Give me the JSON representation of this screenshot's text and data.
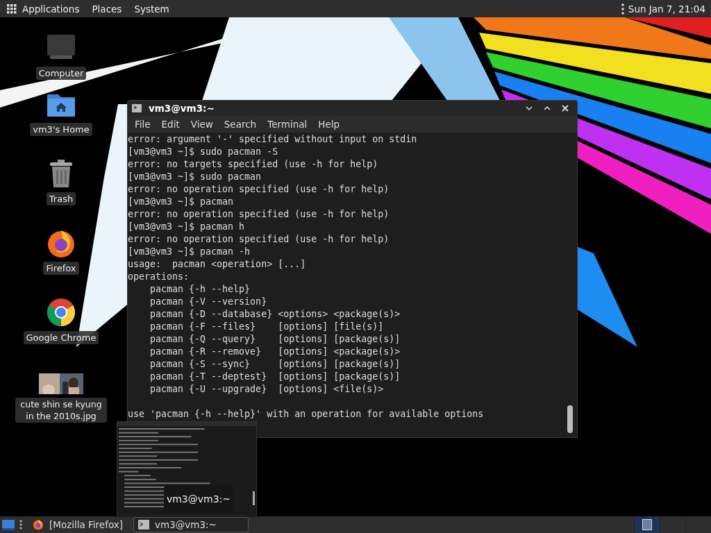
{
  "top_panel": {
    "menus": [
      "Applications",
      "Places",
      "System"
    ],
    "clock": "Sun Jan 7, 21:04"
  },
  "desktop_icons": [
    {
      "kind": "computer",
      "label": "Computer"
    },
    {
      "kind": "home",
      "label": "vm3's Home"
    },
    {
      "kind": "trash",
      "label": "Trash"
    },
    {
      "kind": "firefox",
      "label": "Firefox"
    },
    {
      "kind": "chrome",
      "label": "Google Chrome"
    },
    {
      "label": "cute shin se kyung in the 2010s.jpg"
    }
  ],
  "terminal": {
    "title": "vm3@vm3:~",
    "menu": [
      "File",
      "Edit",
      "View",
      "Search",
      "Terminal",
      "Help"
    ],
    "lines": [
      {
        "kind": "text",
        "text": "error: argument '-' specified without input on stdin"
      },
      {
        "kind": "text",
        "text": "[vm3@vm3 ~]$ sudo pacman -S"
      },
      {
        "kind": "text",
        "text": "error: no targets specified (use -h for help)"
      },
      {
        "kind": "text",
        "text": "[vm3@vm3 ~]$ sudo pacman"
      },
      {
        "kind": "text",
        "text": "error: no operation specified (use -h for help)"
      },
      {
        "kind": "text",
        "text": "[vm3@vm3 ~]$ pacman"
      },
      {
        "kind": "text",
        "text": "error: no operation specified (use -h for help)"
      },
      {
        "kind": "text",
        "text": "[vm3@vm3 ~]$ pacman h"
      },
      {
        "kind": "text",
        "text": "error: no operation specified (use -h for help)"
      },
      {
        "kind": "text",
        "text": "[vm3@vm3 ~]$ pacman -h"
      },
      {
        "kind": "text",
        "text": "usage:  pacman <operation> [...]"
      },
      {
        "kind": "text",
        "text": "operations:"
      },
      {
        "kind": "text",
        "text": "    pacman {-h --help}"
      },
      {
        "kind": "text",
        "text": "    pacman {-V --version}"
      },
      {
        "kind": "text",
        "text": "    pacman {-D --database} <options> <package(s)>"
      },
      {
        "kind": "text",
        "text": "    pacman {-F --files}    [options] [file(s)]"
      },
      {
        "kind": "text",
        "text": "    pacman {-Q --query}    [options] [package(s)]"
      },
      {
        "kind": "text",
        "text": "    pacman {-R --remove}   [options] <package(s)>"
      },
      {
        "kind": "text",
        "text": "    pacman {-S --sync}     [options] [package(s)]"
      },
      {
        "kind": "text",
        "text": "    pacman {-T --deptest}  [options] [package(s)]"
      },
      {
        "kind": "text",
        "text": "    pacman {-U --upgrade}  [options] <file(s)>"
      },
      {
        "kind": "blank"
      },
      {
        "kind": "text",
        "text": "use 'pacman {-h --help}' with an operation for available options"
      }
    ]
  },
  "preview": {
    "tooltip": "vm3@vm3:~"
  },
  "taskbar": {
    "tasks": [
      {
        "kind": "firefox",
        "label": "[Mozilla Firefox]",
        "selected": false
      },
      {
        "kind": "terminal",
        "label": "vm3@vm3:~",
        "selected": true
      }
    ],
    "workspaces": [
      {
        "selected": true
      },
      {
        "selected": false
      },
      {
        "selected": false
      }
    ]
  }
}
